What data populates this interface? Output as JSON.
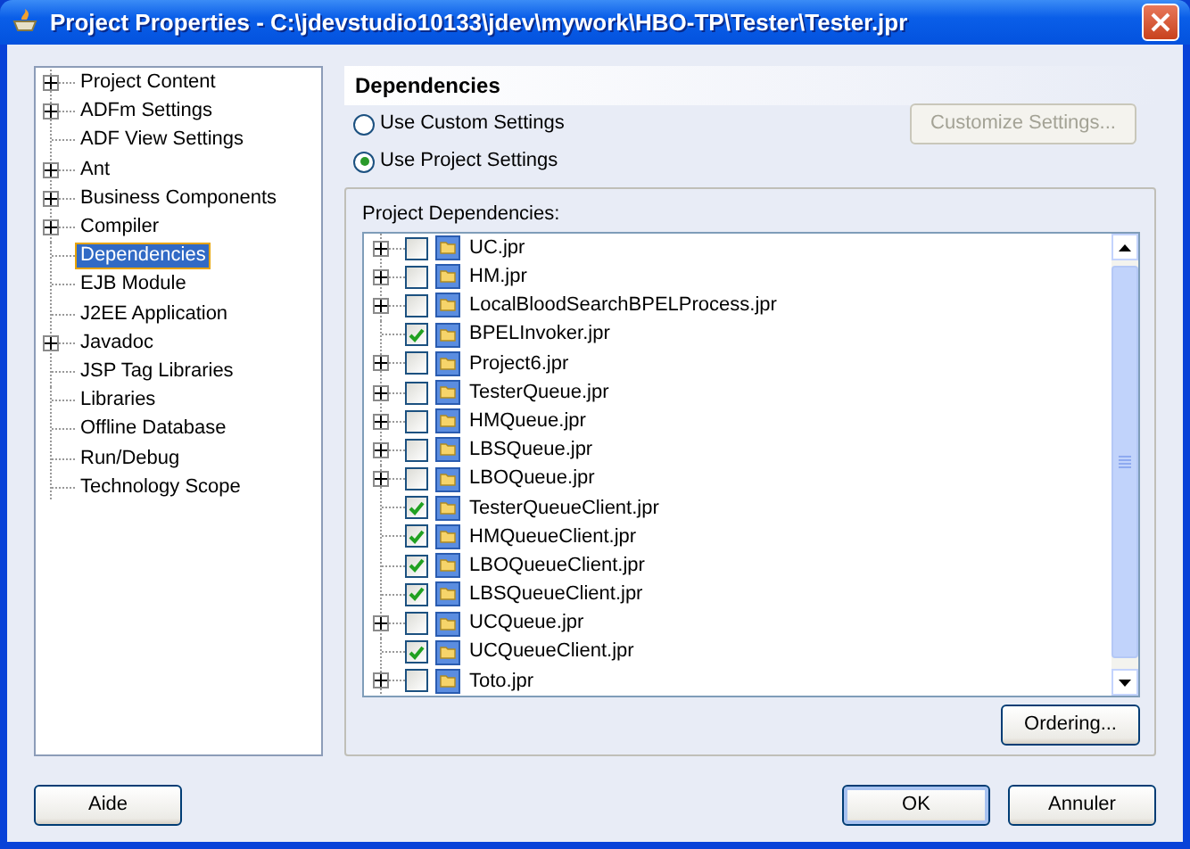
{
  "window": {
    "title": "Project Properties - C:\\jdevstudio10133\\jdev\\mywork\\HBO-TP\\Tester\\Tester.jpr"
  },
  "sidebar": {
    "items": [
      {
        "label": "Project Content",
        "expandable": true,
        "selected": false
      },
      {
        "label": "ADFm Settings",
        "expandable": true,
        "selected": false
      },
      {
        "label": "ADF View Settings",
        "expandable": false,
        "selected": false
      },
      {
        "label": "Ant",
        "expandable": true,
        "selected": false
      },
      {
        "label": "Business Components",
        "expandable": true,
        "selected": false
      },
      {
        "label": "Compiler",
        "expandable": true,
        "selected": false
      },
      {
        "label": "Dependencies",
        "expandable": false,
        "selected": true
      },
      {
        "label": "EJB Module",
        "expandable": false,
        "selected": false
      },
      {
        "label": "J2EE Application",
        "expandable": false,
        "selected": false
      },
      {
        "label": "Javadoc",
        "expandable": true,
        "selected": false
      },
      {
        "label": "JSP Tag Libraries",
        "expandable": false,
        "selected": false
      },
      {
        "label": "Libraries",
        "expandable": false,
        "selected": false
      },
      {
        "label": "Offline Database",
        "expandable": false,
        "selected": false
      },
      {
        "label": "Run/Debug",
        "expandable": false,
        "selected": false
      },
      {
        "label": "Technology Scope",
        "expandable": false,
        "selected": false
      }
    ]
  },
  "panel": {
    "title": "Dependencies",
    "options": [
      {
        "label": "Use Custom Settings",
        "selected": false
      },
      {
        "label": "Use Project Settings",
        "selected": true
      }
    ],
    "customize_button": {
      "label": "Customize Settings...",
      "disabled": true
    },
    "group_label": "Project Dependencies:",
    "dependencies": [
      {
        "name": "UC.jpr",
        "expandable": true,
        "checked": false
      },
      {
        "name": "HM.jpr",
        "expandable": true,
        "checked": false
      },
      {
        "name": "LocalBloodSearchBPELProcess.jpr",
        "expandable": true,
        "checked": false
      },
      {
        "name": "BPELInvoker.jpr",
        "expandable": false,
        "checked": true
      },
      {
        "name": "Project6.jpr",
        "expandable": true,
        "checked": false
      },
      {
        "name": "TesterQueue.jpr",
        "expandable": true,
        "checked": false
      },
      {
        "name": "HMQueue.jpr",
        "expandable": true,
        "checked": false
      },
      {
        "name": "LBSQueue.jpr",
        "expandable": true,
        "checked": false
      },
      {
        "name": "LBOQueue.jpr",
        "expandable": true,
        "checked": false
      },
      {
        "name": "TesterQueueClient.jpr",
        "expandable": false,
        "checked": true
      },
      {
        "name": "HMQueueClient.jpr",
        "expandable": false,
        "checked": true
      },
      {
        "name": "LBOQueueClient.jpr",
        "expandable": false,
        "checked": true
      },
      {
        "name": "LBSQueueClient.jpr",
        "expandable": false,
        "checked": true
      },
      {
        "name": "UCQueue.jpr",
        "expandable": true,
        "checked": false
      },
      {
        "name": "UCQueueClient.jpr",
        "expandable": false,
        "checked": true
      },
      {
        "name": "Toto.jpr",
        "expandable": true,
        "checked": false
      }
    ],
    "ordering_button": "Ordering..."
  },
  "buttons": [
    {
      "label": "Aide",
      "default": false
    },
    {
      "label": "OK",
      "default": true
    },
    {
      "label": "Annuler",
      "default": false
    }
  ]
}
